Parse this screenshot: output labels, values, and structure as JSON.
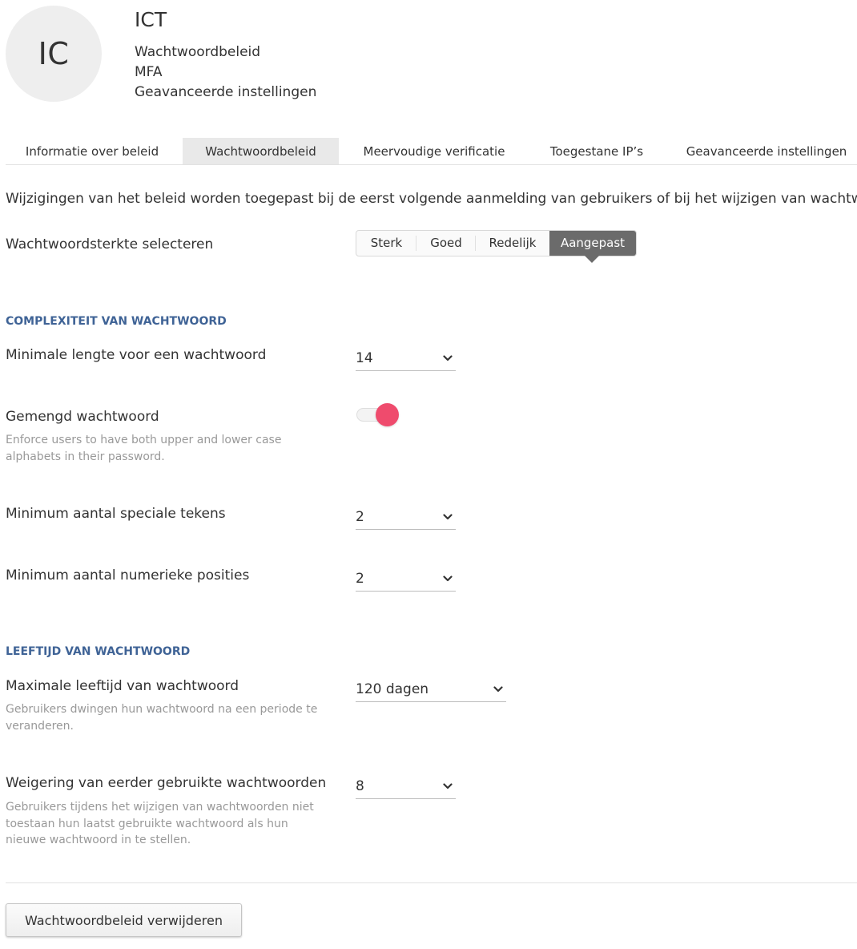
{
  "header": {
    "avatar_initials": "IC",
    "title": "ICT",
    "links": [
      "Wachtwoordbeleid",
      "MFA",
      "Geavanceerde instellingen"
    ]
  },
  "tabs": [
    {
      "label": "Informatie over beleid",
      "active": false
    },
    {
      "label": "Wachtwoordbeleid",
      "active": true
    },
    {
      "label": "Meervoudige verificatie",
      "active": false
    },
    {
      "label": "Toegestane IP’s",
      "active": false
    },
    {
      "label": "Geavanceerde instellingen",
      "active": false
    }
  ],
  "intro": "Wijzigingen van het beleid worden toegepast bij de eerst volgende aanmelding van gebruikers of bij het wijzigen van wachtwoord.",
  "strength": {
    "label": "Wachtwoordsterkte selecteren",
    "options": [
      "Sterk",
      "Goed",
      "Redelijk",
      "Aangepast"
    ],
    "selected": "Aangepast"
  },
  "complexity": {
    "heading": "COMPLEXITEIT VAN WACHTWOORD",
    "min_length": {
      "label": "Minimale lengte voor een wachtwoord",
      "value": "14"
    },
    "mixed": {
      "label": "Gemengd wachtwoord",
      "help": "Enforce users to have both upper and lower case alphabets in their password.",
      "enabled": true
    },
    "min_special": {
      "label": "Minimum aantal speciale tekens",
      "value": "2"
    },
    "min_numeric": {
      "label": "Minimum aantal numerieke posities",
      "value": "2"
    }
  },
  "age": {
    "heading": "LEEFTIJD VAN WACHTWOORD",
    "max_age": {
      "label": "Maximale leeftijd van wachtwoord",
      "help": "Gebruikers dwingen hun wachtwoord na een periode te veranderen.",
      "value": "120 dagen"
    },
    "history": {
      "label": "Weigering van eerder gebruikte wachtwoorden",
      "help": "Gebruikers tijdens het wijzigen van wachtwoorden niet toestaan hun laatst gebruikte wachtwoord als hun nieuwe wachtwoord in te stellen.",
      "value": "8"
    }
  },
  "actions": {
    "delete_label": "Wachtwoordbeleid verwijderen"
  },
  "colors": {
    "accent": "#ef4b6d",
    "section_heading": "#3f6396",
    "segment_active": "#6b6b6b"
  }
}
